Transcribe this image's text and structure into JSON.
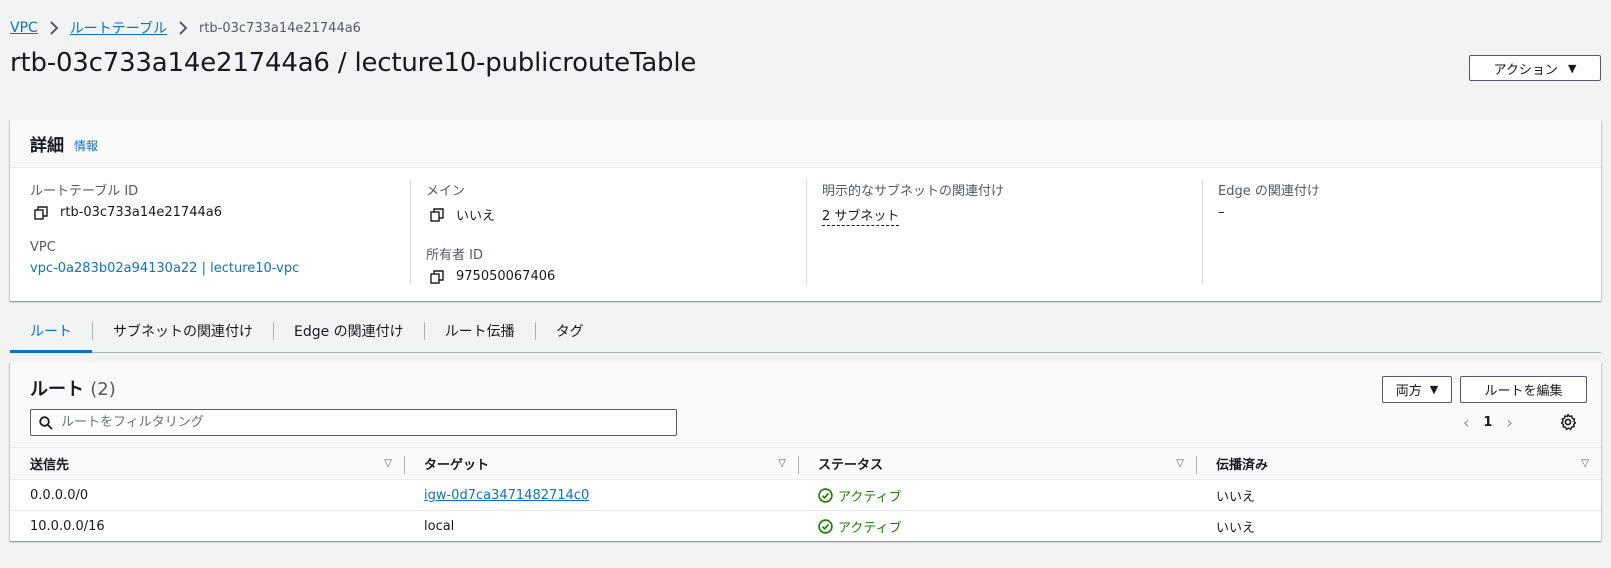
{
  "breadcrumb": {
    "items": [
      "VPC",
      "ルートテーブル"
    ],
    "current": "rtb-03c733a14e21744a6"
  },
  "header": {
    "title": "rtb-03c733a14e21744a6 / lecture10-publicrouteTable",
    "actions_label": "アクション"
  },
  "details": {
    "title": "詳細",
    "info_label": "情報",
    "route_table_id_label": "ルートテーブル ID",
    "route_table_id": "rtb-03c733a14e21744a6",
    "vpc_label": "VPC",
    "vpc_value": "vpc-0a283b02a94130a22 | lecture10-vpc",
    "main_label": "メイン",
    "main_value": "いいえ",
    "owner_id_label": "所有者 ID",
    "owner_id": "975050067406",
    "explicit_subnet_label": "明示的なサブネットの関連付け",
    "explicit_subnet_value": "2 サブネット",
    "edge_assoc_label": "Edge の関連付け",
    "edge_assoc_value": "–"
  },
  "tabs": [
    {
      "label": "ルート",
      "active": true
    },
    {
      "label": "サブネットの関連付け",
      "active": false
    },
    {
      "label": "Edge の関連付け",
      "active": false
    },
    {
      "label": "ルート伝播",
      "active": false
    },
    {
      "label": "タグ",
      "active": false
    }
  ],
  "routes": {
    "title": "ルート",
    "count": "(2)",
    "direction_select": "両方",
    "edit_button": "ルートを編集",
    "search_placeholder": "ルートをフィルタリング",
    "page": "1",
    "columns": [
      "送信先",
      "ターゲット",
      "ステータス",
      "伝播済み"
    ],
    "rows": [
      {
        "destination": "0.0.0.0/0",
        "target": "igw-0d7ca3471482714c0",
        "target_is_link": true,
        "status": "アクティブ",
        "propagated": "いいえ"
      },
      {
        "destination": "10.0.0.0/16",
        "target": "local",
        "target_is_link": false,
        "status": "アクティブ",
        "propagated": "いいえ"
      }
    ]
  },
  "colors": {
    "link": "#0972d3",
    "success": "#1d8102",
    "background": "#f2f3f3"
  }
}
